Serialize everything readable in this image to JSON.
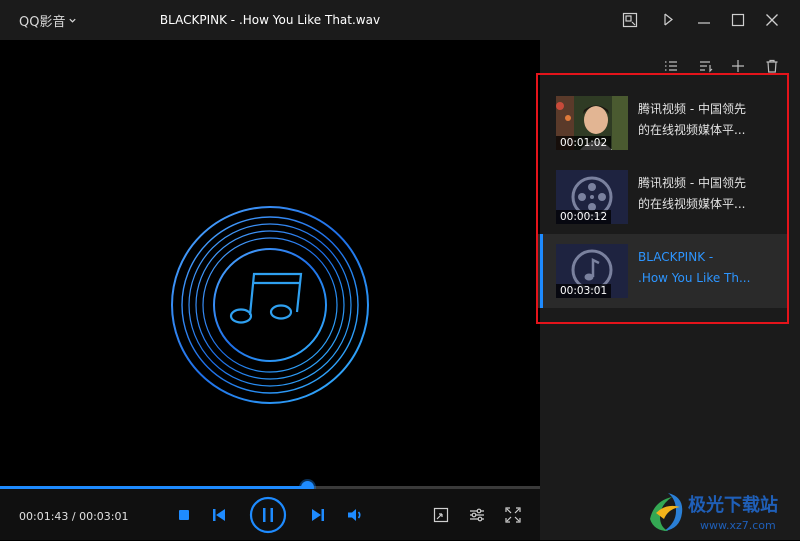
{
  "app": {
    "name": "QQ影音",
    "media_title": "BLACKPINK - .How You Like That.wav"
  },
  "playlist": [
    {
      "title_line1": "腾讯视频 - 中国领先",
      "title_line2": "的在线视频媒体平...",
      "duration": "00:01:02",
      "thumbnail": "person-photo",
      "active": false
    },
    {
      "title_line1": "腾讯视频 - 中国领先",
      "title_line2": "的在线视频媒体平...",
      "duration": "00:00:12",
      "thumbnail": "film-reel-icon",
      "active": false
    },
    {
      "title_line1": "BLACKPINK -",
      "title_line2": ".How You Like Th...",
      "duration": "00:03:01",
      "thumbnail": "music-note-icon",
      "active": true
    }
  ],
  "player": {
    "current_time": "00:01:43",
    "total_time": "00:03:01",
    "time_display": "00:01:43 / 00:03:01",
    "progress_fraction": 0.569
  },
  "colors": {
    "accent": "#1e8bff",
    "highlight_border": "#e4141b",
    "background": "#000000",
    "panel": "#1b1b1b"
  },
  "watermark": {
    "name": "极光下载站",
    "url": "www.xz7.com"
  }
}
